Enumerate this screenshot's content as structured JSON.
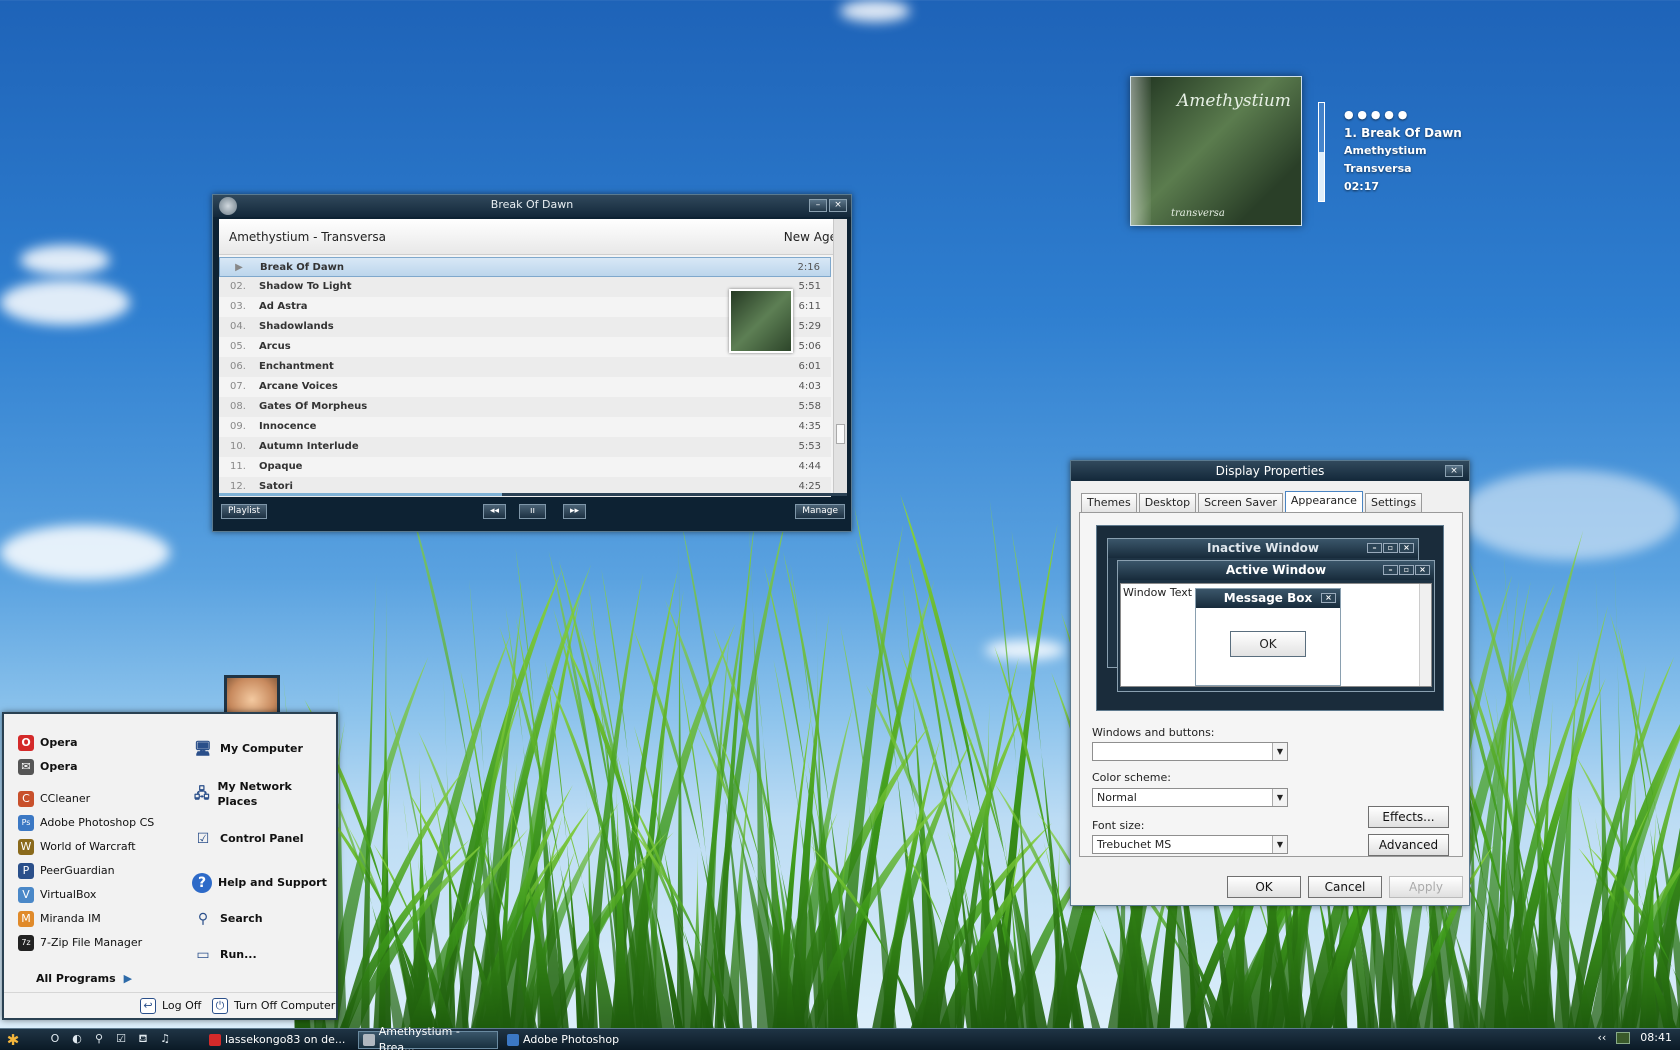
{
  "player": {
    "title": "Break Of Dawn",
    "album_line": "Amethystium - Transversa",
    "genre": "New Age",
    "tracks": [
      {
        "num": "",
        "title": "Break Of Dawn",
        "dur": "2:16"
      },
      {
        "num": "02.",
        "title": "Shadow To Light",
        "dur": "5:51"
      },
      {
        "num": "03.",
        "title": "Ad Astra",
        "dur": "6:11"
      },
      {
        "num": "04.",
        "title": "Shadowlands",
        "dur": "5:29"
      },
      {
        "num": "05.",
        "title": "Arcus",
        "dur": "5:06"
      },
      {
        "num": "06.",
        "title": "Enchantment",
        "dur": "6:01"
      },
      {
        "num": "07.",
        "title": "Arcane Voices",
        "dur": "4:03"
      },
      {
        "num": "08.",
        "title": "Gates Of Morpheus",
        "dur": "5:58"
      },
      {
        "num": "09.",
        "title": "Innocence",
        "dur": "4:35"
      },
      {
        "num": "10.",
        "title": "Autumn Interlude",
        "dur": "5:53"
      },
      {
        "num": "11.",
        "title": "Opaque",
        "dur": "4:44"
      },
      {
        "num": "12.",
        "title": "Satori",
        "dur": "4:25"
      }
    ],
    "buttons": {
      "playlist": "Playlist",
      "prev": "◂◂",
      "pause": "ıı",
      "next": "▸▸",
      "manage": "Manage"
    },
    "progress": 0.45
  },
  "now_playing": {
    "cover_title": "Amethystium",
    "cover_subtitle": "transversa",
    "rating": "● ● ● ● ●",
    "track": "1. Break Of Dawn",
    "artist": "Amethystium",
    "album": "Transversa",
    "time": "02:17",
    "volume": 0.5
  },
  "display": {
    "title": "Display Properties",
    "tabs": [
      "Themes",
      "Desktop",
      "Screen Saver",
      "Appearance",
      "Settings"
    ],
    "active_tab": "Appearance",
    "preview": {
      "inactive": "Inactive Window",
      "active": "Active Window",
      "window_text": "Window Text",
      "message_box": "Message Box",
      "ok": "OK"
    },
    "windows_buttons_label": "Windows and buttons:",
    "windows_buttons_value": "",
    "color_scheme_label": "Color scheme:",
    "color_scheme_value": "Normal",
    "font_size_label": "Font size:",
    "font_size_value": "Trebuchet MS",
    "effects": "Effects...",
    "advanced": "Advanced",
    "ok": "OK",
    "cancel": "Cancel",
    "apply": "Apply"
  },
  "start_menu": {
    "left": [
      {
        "label": "Opera",
        "icon": "opera-icon",
        "color": "#d42a2a",
        "glyph": "O"
      },
      {
        "label": "Opera",
        "icon": "mail-icon",
        "color": "#555555",
        "glyph": "✉"
      },
      {
        "label": "CCleaner",
        "icon": "ccleaner-icon",
        "color": "#c8502c",
        "glyph": "C"
      },
      {
        "label": "Adobe Photoshop CS",
        "icon": "photoshop-icon",
        "color": "#3b78c4",
        "glyph": "Ps"
      },
      {
        "label": "World of Warcraft",
        "icon": "wow-icon",
        "color": "#8a6a1c",
        "glyph": "W"
      },
      {
        "label": "PeerGuardian",
        "icon": "peerguardian-icon",
        "color": "#2a4f8a",
        "glyph": "P"
      },
      {
        "label": "VirtualBox",
        "icon": "virtualbox-icon",
        "color": "#4a88c8",
        "glyph": "V"
      },
      {
        "label": "Miranda IM",
        "icon": "miranda-icon",
        "color": "#e08a2a",
        "glyph": "M"
      },
      {
        "label": "7-Zip File Manager",
        "icon": "7zip-icon",
        "color": "#222222",
        "glyph": "7z"
      }
    ],
    "all_programs": "All Programs",
    "right": [
      {
        "label": "My Computer",
        "icon": "computer-icon",
        "glyph": "🖥"
      },
      {
        "label": "My Network Places",
        "icon": "network-icon",
        "glyph": "🖧"
      },
      {
        "label": "Control Panel",
        "icon": "control-panel-icon",
        "glyph": "☑"
      },
      {
        "label": "Help and Support",
        "icon": "help-icon",
        "glyph": "?"
      },
      {
        "label": "Search",
        "icon": "search-icon",
        "glyph": "⚲"
      },
      {
        "label": "Run...",
        "icon": "run-icon",
        "glyph": "▭"
      }
    ],
    "log_off": "Log Off",
    "turn_off": "Turn Off Computer"
  },
  "taskbar": {
    "quick_launch": [
      "O",
      "◐",
      "⚲",
      "☑",
      "⛾",
      "♫"
    ],
    "tasks": [
      {
        "label": "lassekongo83 on de...",
        "color": "#d42a2a",
        "active": false
      },
      {
        "label": "Amethystium - Brea...",
        "color": "#b0b8c0",
        "active": true
      },
      {
        "label": "Adobe Photoshop",
        "color": "#3b78c4",
        "active": false
      }
    ],
    "clock": "08:41",
    "tray_arrow": "‹‹"
  }
}
